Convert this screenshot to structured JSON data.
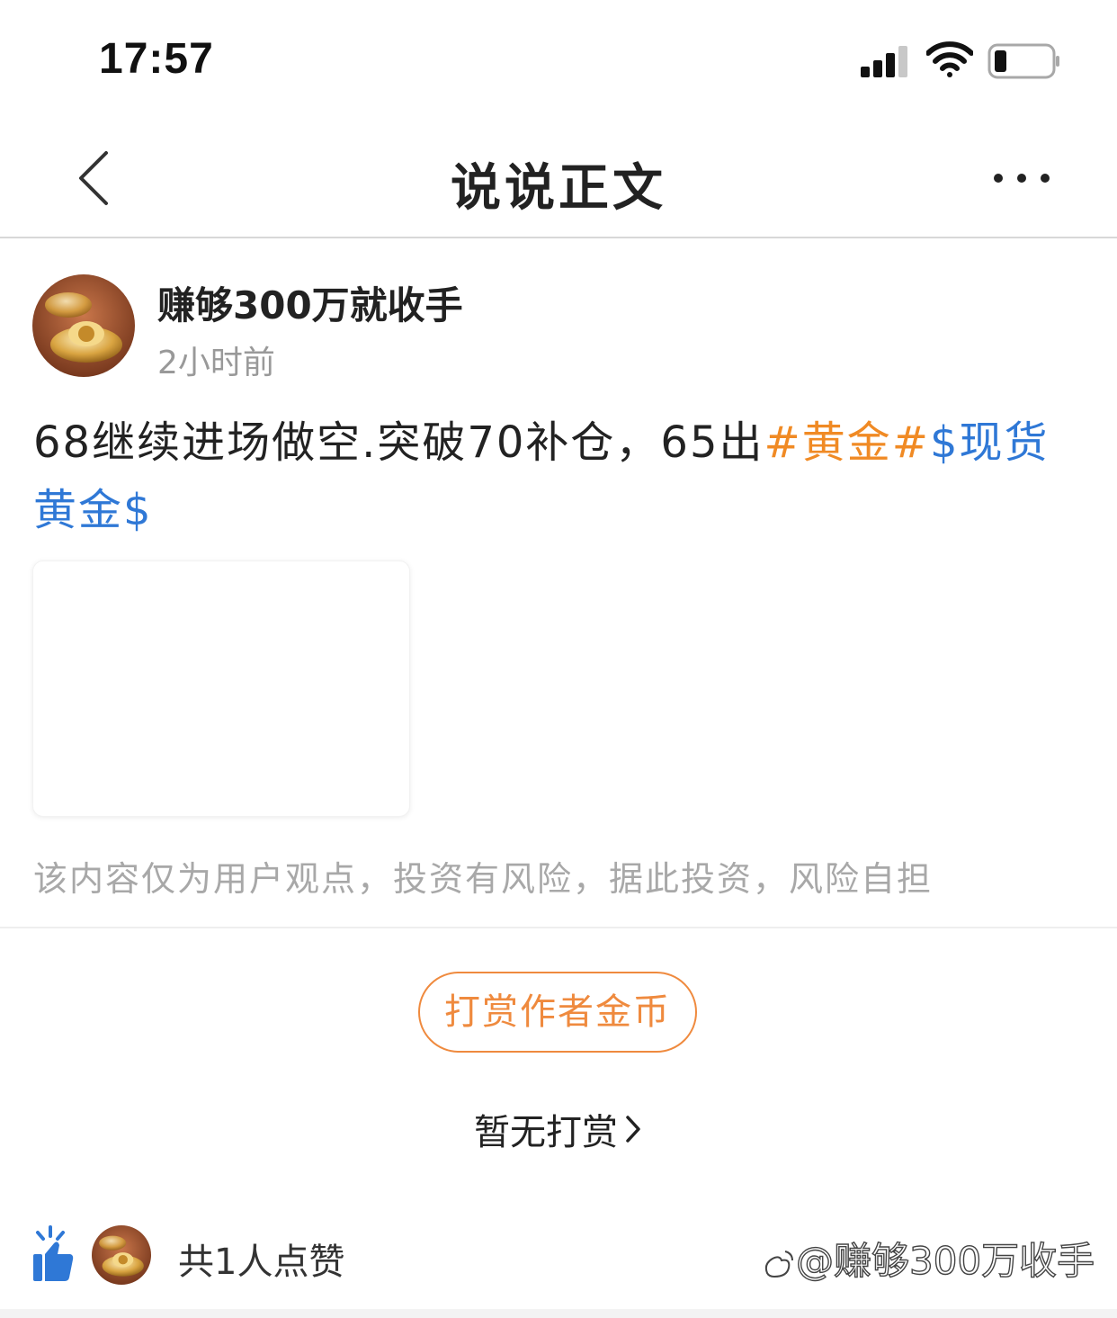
{
  "status_bar": {
    "time": "17:57"
  },
  "nav": {
    "title": "说说正文"
  },
  "post": {
    "author": "赚够300万就收手",
    "time": "2小时前",
    "text_plain": "68继续进场做空.突破70补仓，65出",
    "topic_tag": "#黄金#",
    "stock_tag": "$现货黄金$",
    "disclaimer": "该内容仅为用户观点，投资有风险，据此投资，风险自担"
  },
  "reward": {
    "button_label": "打赏作者金币",
    "status": "暂无打赏"
  },
  "likes": {
    "count_label": "共1人点赞"
  },
  "watermark": {
    "text": "@赚够300万收手"
  },
  "colors": {
    "topic": "#f08a24",
    "stock": "#2f78d6",
    "reward": "#ef8a3e",
    "like_icon": "#2f78d6"
  }
}
